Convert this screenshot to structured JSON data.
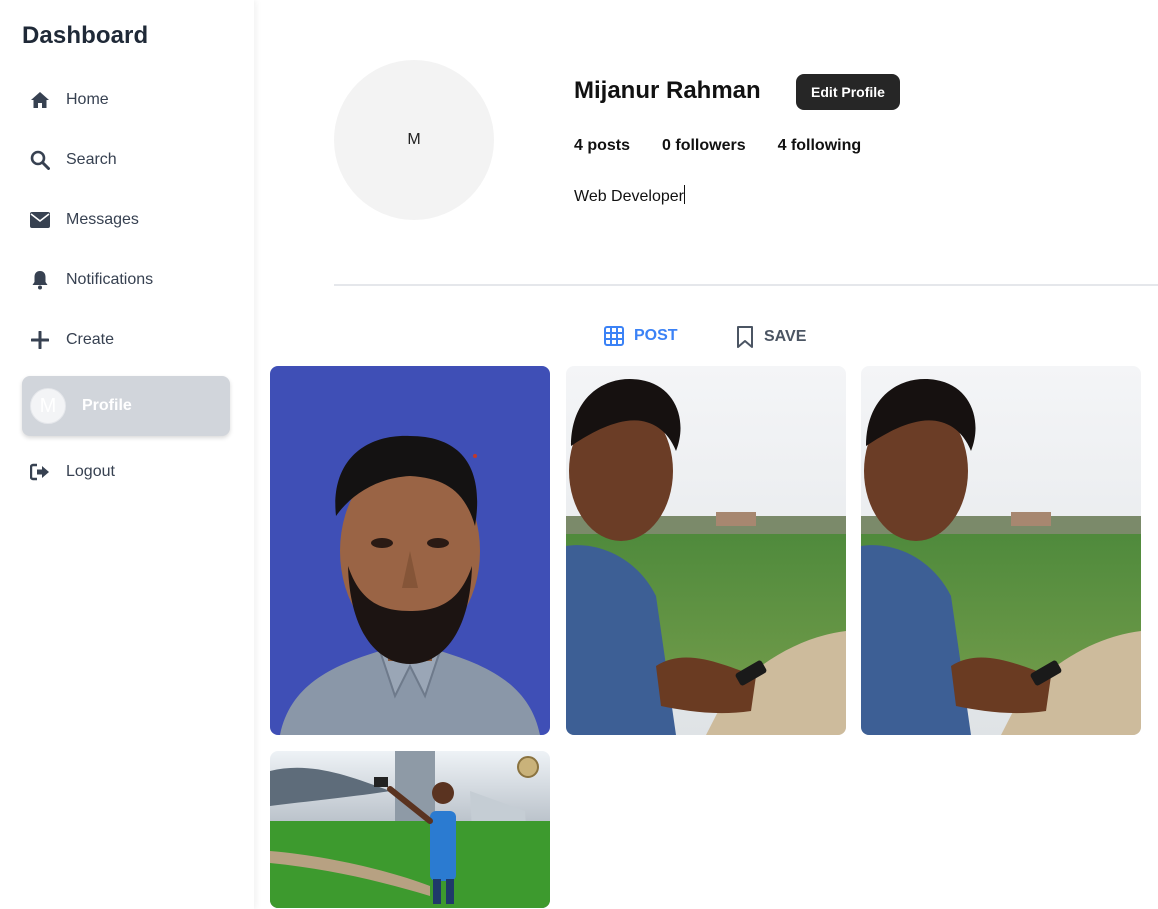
{
  "sidebar": {
    "title": "Dashboard",
    "items": [
      {
        "label": "Home",
        "icon": "home-icon"
      },
      {
        "label": "Search",
        "icon": "search-icon"
      },
      {
        "label": "Messages",
        "icon": "envelope-icon"
      },
      {
        "label": "Notifications",
        "icon": "bell-icon"
      },
      {
        "label": "Create",
        "icon": "plus-icon"
      },
      {
        "label": "Profile",
        "icon": "avatar",
        "avatar_initial": "M"
      },
      {
        "label": "Logout",
        "icon": "logout-icon"
      }
    ]
  },
  "profile": {
    "avatar_initial": "M",
    "name": "Mijanur Rahman",
    "edit_label": "Edit Profile",
    "posts": "4 posts",
    "followers": "0 followers",
    "following": "4 following",
    "bio": "Web Developer"
  },
  "tabs": {
    "post": "POST",
    "save": "SAVE"
  },
  "colors": {
    "accent": "#3b82f6",
    "button_bg": "#262626",
    "active_item_bg": "#d1d5db",
    "portrait_bg": "#3f4fb6"
  },
  "posts": [
    {
      "name": "post-portrait-blue-background"
    },
    {
      "name": "post-field-with-phone"
    },
    {
      "name": "post-field-with-phone"
    },
    {
      "name": "post-hdr-field-selfie"
    }
  ]
}
